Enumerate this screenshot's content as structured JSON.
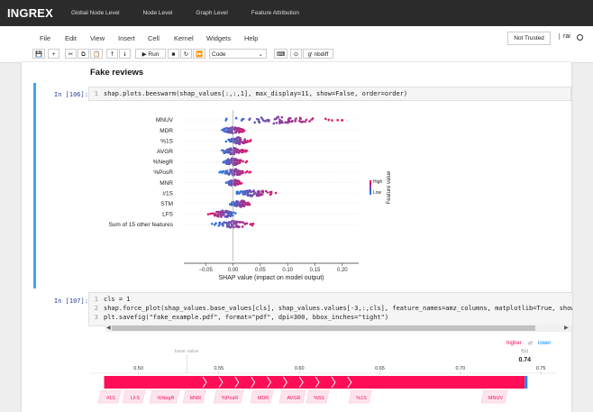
{
  "nav": {
    "brand": "INGREX",
    "links": [
      "Global Node Level",
      "Node Level",
      "Graph Level",
      "Feature Attribution"
    ]
  },
  "menu": {
    "items": [
      "File",
      "Edit",
      "View",
      "Insert",
      "Cell",
      "Kernel",
      "Widgets",
      "Help"
    ],
    "not_trusted": "Not Trusted",
    "kernel": "rai"
  },
  "toolbar": {
    "run_label": "▶ Run",
    "cell_type": "Code",
    "nbdiff_label": "nbdiff"
  },
  "notebook": {
    "heading": "Fake reviews",
    "cell1": {
      "prompt": "In [106]:",
      "code": "shap.plots.beeswarm(shap_values[:,:,1], max_display=11, show=False, order=order)"
    },
    "cell2": {
      "prompt": "In [107]:",
      "lines": [
        "cls = 1",
        "shap.force_plot(shap_values.base_values[cls], shap_values.values[-3,:,cls], feature_names=amz_columns, matplotlib=True, show",
        "plt.savefig(\"fake_example.pdf\", format=\"pdf\", dpi=300, bbox_inches=\"tight\")"
      ]
    }
  },
  "chart_data": [
    {
      "type": "scatter",
      "subtype": "beeswarm",
      "features": [
        "MNUV",
        "MDR",
        "%1S",
        "AVGR",
        "%NegR",
        "%PosR",
        "MNR",
        "#1S",
        "STM",
        "LFS",
        "Sum of 15 other features"
      ],
      "xlabel": "SHAP value (impact on model output)",
      "xticks": [
        "−0.05",
        "0.00",
        "0.05",
        "0.10",
        "0.15",
        "0.20"
      ],
      "xlim": [
        -0.09,
        0.23
      ],
      "colorbar": {
        "label": "Feature value",
        "high": "High",
        "low": "Low",
        "high_color": "#ff0052",
        "low_color": "#008bfb"
      },
      "approx_ranges": [
        {
          "feature": "MNUV",
          "min": -0.06,
          "max": 0.21
        },
        {
          "feature": "MDR",
          "min": -0.03,
          "max": 0.03
        },
        {
          "feature": "%1S",
          "min": -0.02,
          "max": 0.04
        },
        {
          "feature": "AVGR",
          "min": -0.03,
          "max": 0.03
        },
        {
          "feature": "%NegR",
          "min": -0.03,
          "max": 0.03
        },
        {
          "feature": "%PosR",
          "min": -0.03,
          "max": 0.035
        },
        {
          "feature": "MNR",
          "min": -0.02,
          "max": 0.02
        },
        {
          "feature": "#1S",
          "min": -0.01,
          "max": 0.09
        },
        {
          "feature": "STM",
          "min": -0.015,
          "max": 0.04
        },
        {
          "feature": "LFS",
          "min": -0.05,
          "max": 0.015
        },
        {
          "feature": "Sum of 15 other features",
          "min": -0.05,
          "max": 0.05
        }
      ]
    },
    {
      "type": "bar",
      "subtype": "force_plot",
      "higher_label": "higher",
      "lower_label": "lower",
      "arrow_symbol": "⇄",
      "fx_label": "f(x)",
      "fx_value": "0.74",
      "base_label": "base value",
      "base_value": 0.53,
      "ticks": [
        "0.50",
        "0.55",
        "0.60",
        "0.65",
        "0.70",
        "0.75"
      ],
      "xlim": [
        0.47,
        0.76
      ],
      "features_pushing_higher": [
        "#1S",
        "LFS",
        "%NegR",
        "MNR",
        "%PosR",
        "MDR",
        "AVGR",
        "%5S",
        "%1S",
        "MNUV"
      ]
    }
  ]
}
